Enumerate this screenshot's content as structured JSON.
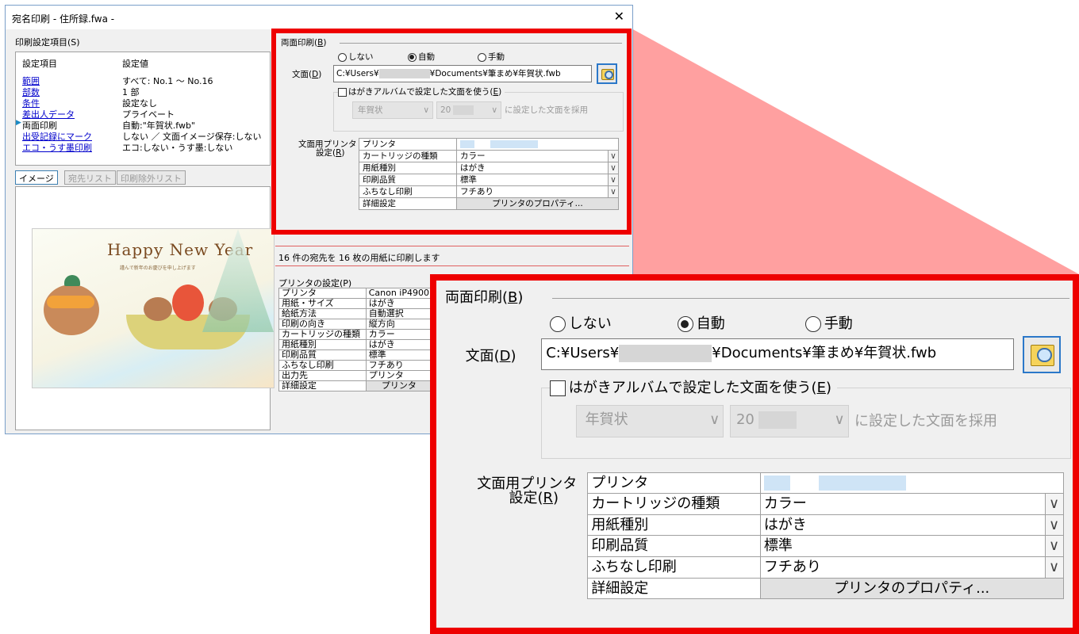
{
  "window": {
    "title": "宛名印刷 - 住所録.fwa -",
    "close": "✕"
  },
  "settings_section": {
    "label": "印刷設定項目(S)"
  },
  "settings_table": {
    "header": [
      "設定項目",
      "設定値"
    ],
    "rows": [
      {
        "item": "範囲",
        "value": "すべて: No.1 〜 No.16",
        "link": true
      },
      {
        "item": "部数",
        "value": "1 部",
        "link": true
      },
      {
        "item": "条件",
        "value": "設定なし",
        "link": true
      },
      {
        "item": "差出人データ",
        "value": "プライベート",
        "link": true
      },
      {
        "item": "両面印刷",
        "value": "自動:\"年賀状.fwb\"",
        "link": false,
        "current": true
      },
      {
        "item": "出受記録にマーク",
        "value": "しない ／ 文面イメージ保存:しない",
        "link": true
      },
      {
        "item": "エコ・うす墨印刷",
        "value": "エコ:しない・うす墨:しない",
        "link": true
      }
    ]
  },
  "tabs": [
    "イメージ",
    "宛先リスト",
    "印刷除外リスト"
  ],
  "preview": {
    "card_text": "Happy New Year",
    "card_sub": "謹んで新年のお慶びを申し上げます"
  },
  "status": "16 件の宛先を 16 枚の用紙に印刷します",
  "printer_settings": {
    "label": "プリンタの設定(P)",
    "rows": [
      [
        "プリンタ",
        "Canon iP4900"
      ],
      [
        "用紙・サイズ",
        "はがき"
      ],
      [
        "給紙方法",
        "自動選択"
      ],
      [
        "印刷の向き",
        "縦方向"
      ],
      [
        "カートリッジの種類",
        "カラー"
      ],
      [
        "用紙種別",
        "はがき"
      ],
      [
        "印刷品質",
        "標準"
      ],
      [
        "ふちなし印刷",
        "フチあり"
      ],
      [
        "出力先",
        "プリンタ"
      ],
      [
        "詳細設定",
        "プリンタ"
      ]
    ]
  },
  "duplex": {
    "label_pre": "両面印刷(",
    "label_key": "B",
    "label_post": ")",
    "options": [
      "しない",
      "自動",
      "手動"
    ],
    "selected": "自動",
    "design_label_pre": "文面(",
    "design_key": "D",
    "design_label_post": ")",
    "path_prefix": "C:¥Users¥",
    "path_suffix": "¥Documents¥筆まめ¥年賀状.fwb",
    "use_album_pre": "はがきアルバムで設定した文面を使う(",
    "use_album_key": "E",
    "use_album_post": ")",
    "album_combo1": "年賀状",
    "album_combo2": "20",
    "album_suffix": "に設定した文面を採用",
    "printer_label_line1": "文面用プリンタ",
    "printer_label_line2_pre": "設定(",
    "printer_label_key": "R",
    "printer_label_line2_post": ")",
    "printer_grid": [
      {
        "key": "プリンタ",
        "value": "",
        "dropdown": false
      },
      {
        "key": "カートリッジの種類",
        "value": "カラー",
        "dropdown": true
      },
      {
        "key": "用紙種別",
        "value": "はがき",
        "dropdown": true
      },
      {
        "key": "印刷品質",
        "value": "標準",
        "dropdown": true
      },
      {
        "key": "ふちなし印刷",
        "value": "フチあり",
        "dropdown": true
      },
      {
        "key": "詳細設定",
        "value": "プリンタのプロパティ...",
        "dropdown": false,
        "button": true
      }
    ]
  },
  "colors": {
    "highlight": "#ee0000",
    "zoom_fill": "#ff8a8a",
    "link": "#0000cc",
    "accent": "#2b78c9"
  }
}
